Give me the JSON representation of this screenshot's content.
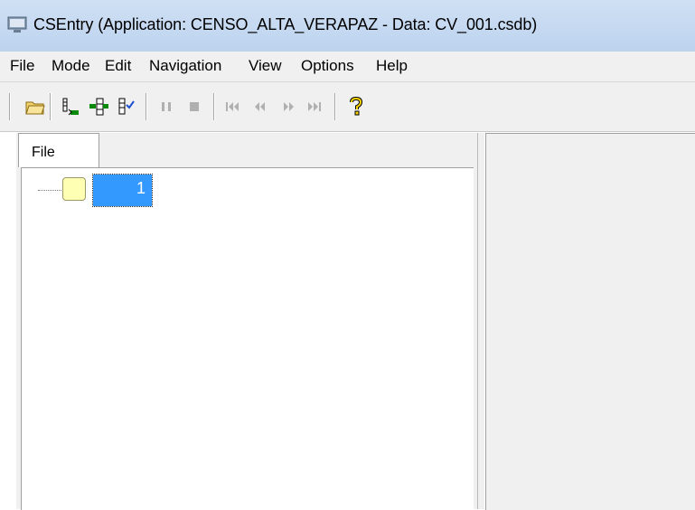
{
  "window": {
    "title": "CSEntry (Application: CENSO_ALTA_VERAPAZ - Data: CV_001.csdb)",
    "icon": "monitor-icon"
  },
  "menu": {
    "items": [
      "File",
      "Mode",
      "Edit",
      "Navigation",
      "View",
      "Options",
      "Help"
    ]
  },
  "toolbar": {
    "buttons": [
      "open-folder-icon",
      "add-case-icon",
      "insert-case-icon",
      "verify-case-icon",
      "pause-icon",
      "stop-icon",
      "first-icon",
      "previous-icon",
      "next-icon",
      "last-icon",
      "help-icon"
    ]
  },
  "left_panel": {
    "tab_label": "File",
    "tree": {
      "node_label": "1"
    }
  },
  "colors": {
    "selection": "#3399ff",
    "node_icon": "#ffffb3",
    "titlebar": "#c4d8f1",
    "chrome": "#f0f0f0"
  }
}
